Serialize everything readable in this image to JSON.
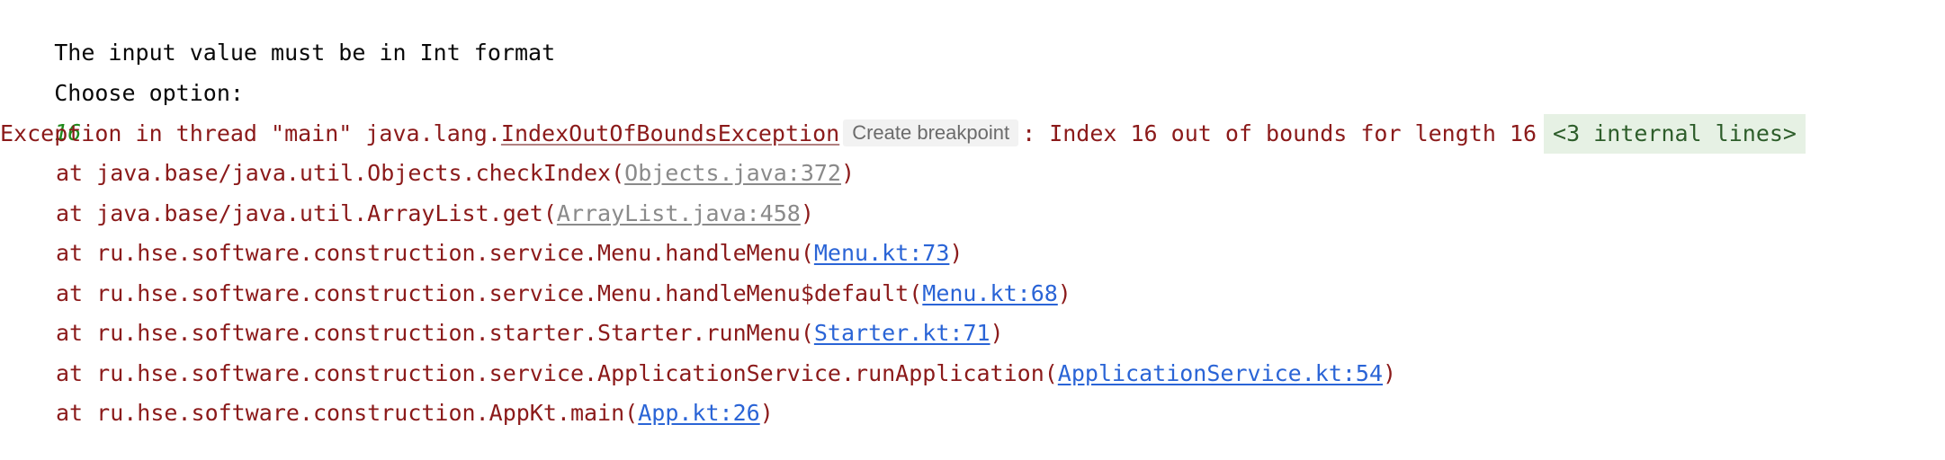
{
  "console": {
    "line1": "The input value must be in Int format",
    "line2": "Choose option:",
    "user_input": "16",
    "exception": {
      "prefix": "Exception in thread \"main\" java.lang.",
      "class_name": "IndexOutOfBoundsException",
      "breakpoint_label": "Create breakpoint",
      "message": ": Index 16 out of bounds for length 16",
      "internal_lines": "<3 internal lines>"
    },
    "stack": [
      {
        "text": "at java.base/java.util.Objects.checkIndex(",
        "link": "Objects.java:372",
        "suffix": ")"
      },
      {
        "text": "at java.base/java.util.ArrayList.get(",
        "link": "ArrayList.java:458",
        "suffix": ")"
      },
      {
        "text": "at ru.hse.software.construction.service.Menu.handleMenu(",
        "link": "Menu.kt:73",
        "suffix": ")"
      },
      {
        "text": "at ru.hse.software.construction.service.Menu.handleMenu$default(",
        "link": "Menu.kt:68",
        "suffix": ")"
      },
      {
        "text": "at ru.hse.software.construction.starter.Starter.runMenu(",
        "link": "Starter.kt:71",
        "suffix": ")"
      },
      {
        "text": "at ru.hse.software.construction.service.ApplicationService.runApplication(",
        "link": "ApplicationService.kt:54",
        "suffix": ")"
      },
      {
        "text": "at ru.hse.software.construction.AppKt.main(",
        "link": "App.kt:26",
        "suffix": ")"
      }
    ]
  },
  "colors": {
    "background": "#ffffff",
    "error_text": "#8b1a1a",
    "user_input": "#1f8a1a",
    "source_link": "#2a64d6",
    "library_link": "#8a8a8a",
    "internal_lines_bg": "#e6f1e4"
  }
}
